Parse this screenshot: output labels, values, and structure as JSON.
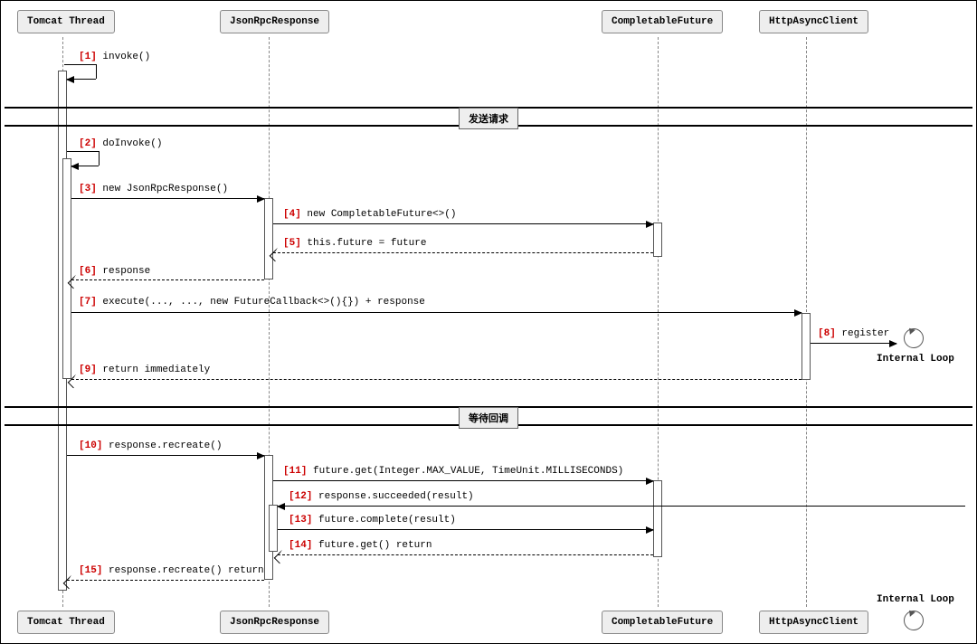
{
  "participants": {
    "p1": "Tomcat Thread",
    "p2": "JsonRpcResponse",
    "p3": "CompletableFuture",
    "p4": "HttpAsyncClient",
    "loop": "Internal Loop"
  },
  "dividers": {
    "d1": "发送请求",
    "d2": "等待回调"
  },
  "messages": {
    "m1_num": "[1]",
    "m1_txt": "invoke()",
    "m2_num": "[2]",
    "m2_txt": "doInvoke()",
    "m3_num": "[3]",
    "m3_txt": "new JsonRpcResponse()",
    "m4_num": "[4]",
    "m4_txt": "new CompletableFuture<>()",
    "m5_num": "[5]",
    "m5_txt": "this.future = future",
    "m6_num": "[6]",
    "m6_txt": "response",
    "m7_num": "[7]",
    "m7_txt": "execute(..., ..., new FutureCallback<>(){}) + response",
    "m8_num": "[8]",
    "m8_txt": "register",
    "m9_num": "[9]",
    "m9_txt": "return immediately",
    "m10_num": "[10]",
    "m10_txt": "response.recreate()",
    "m11_num": "[11]",
    "m11_txt": "future.get(Integer.MAX_VALUE, TimeUnit.MILLISECONDS)",
    "m12_num": "[12]",
    "m12_txt": "response.succeeded(result)",
    "m13_num": "[13]",
    "m13_txt": "future.complete(result)",
    "m14_num": "[14]",
    "m14_txt": "future.get() return",
    "m15_num": "[15]",
    "m15_txt": "response.recreate() return"
  }
}
